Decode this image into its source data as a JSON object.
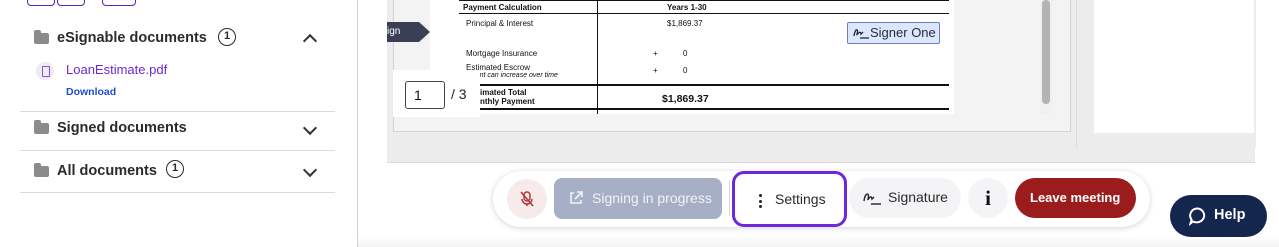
{
  "sidebar": {
    "sections": [
      {
        "label": "eSignable documents",
        "count": "1",
        "expanded": true
      },
      {
        "label": "Signed documents",
        "expanded": false
      },
      {
        "label": "All documents",
        "count": "1",
        "expanded": false
      }
    ],
    "file": {
      "name": "LoanEstimate.pdf",
      "action": "Download"
    }
  },
  "document": {
    "sign_tab": "ign",
    "header_left": "Payment Calculation",
    "header_right": "Years 1-30",
    "rows": [
      {
        "label": "Principal & Interest",
        "value": "$1,869.37"
      },
      {
        "label": "Mortgage Insurance",
        "op": "+",
        "value": "0"
      },
      {
        "label": "Estimated Escrow",
        "sublabel": "mount can increase over time",
        "op": "+",
        "value": "0"
      }
    ],
    "total_label_1": "imated Total",
    "total_label_2": "nthly Payment",
    "total_value": "$1,869.37",
    "signer_tag": "Signer One"
  },
  "pager": {
    "current": "1",
    "total": "/ 3"
  },
  "toolbar": {
    "signing_label": "Signing in progress",
    "settings_label": "Settings",
    "signature_label": "Signature",
    "info_label": "i",
    "leave_label": "Leave meeting",
    "colors": {
      "leave": "#9b1c1c",
      "focus_ring": "#6d28d9",
      "signing_disabled": "#a6afc5"
    }
  },
  "help": {
    "label": "Help"
  }
}
